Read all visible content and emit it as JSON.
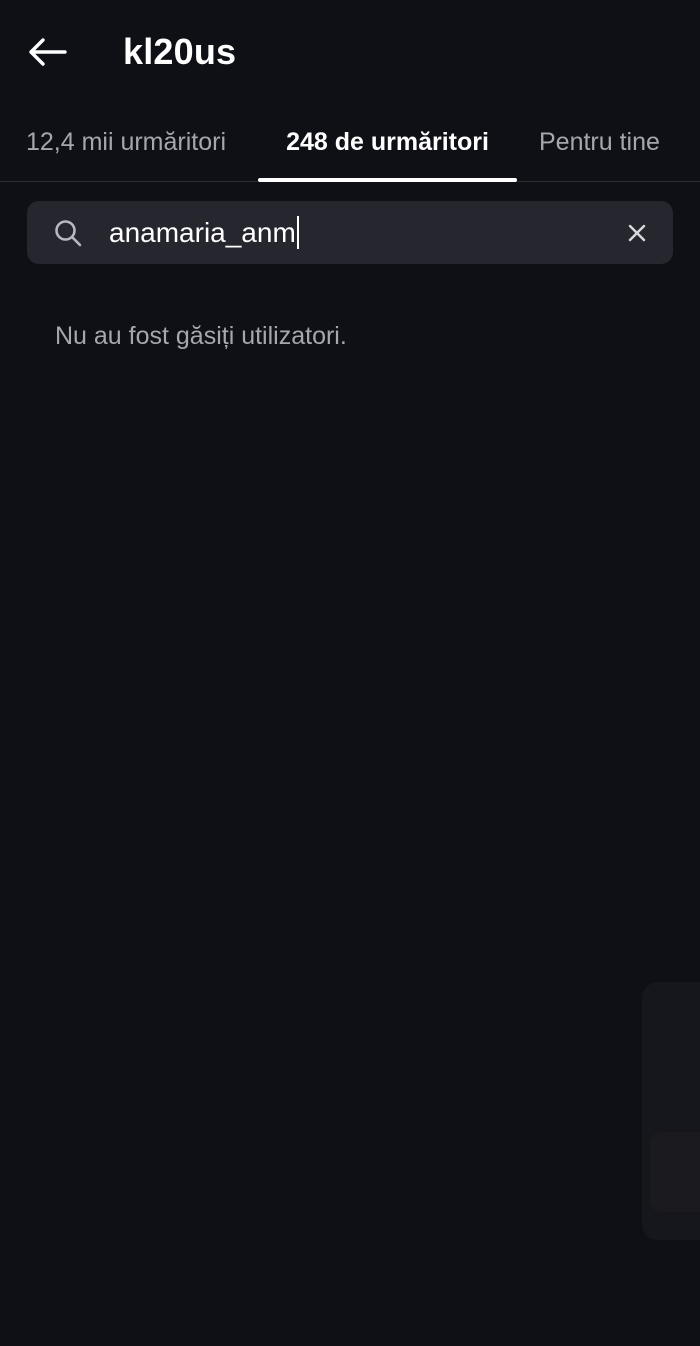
{
  "header": {
    "title": "kl20us",
    "back_icon": "arrow-left-icon"
  },
  "tabs": [
    {
      "label": "12,4 mii urmăritori",
      "active": false
    },
    {
      "label": "248 de urmăritori",
      "active": true
    },
    {
      "label": "Pentru tine",
      "active": false
    }
  ],
  "search": {
    "value": "anamaria_anm",
    "icon": "search-icon",
    "clear_icon": "close-icon"
  },
  "results": {
    "empty_message": "Nu au fost găsiți utilizatori."
  },
  "colors": {
    "background": "#0f1016",
    "search_background": "#25262e",
    "text_primary": "#ffffff",
    "text_secondary": "#a6a7ae"
  }
}
